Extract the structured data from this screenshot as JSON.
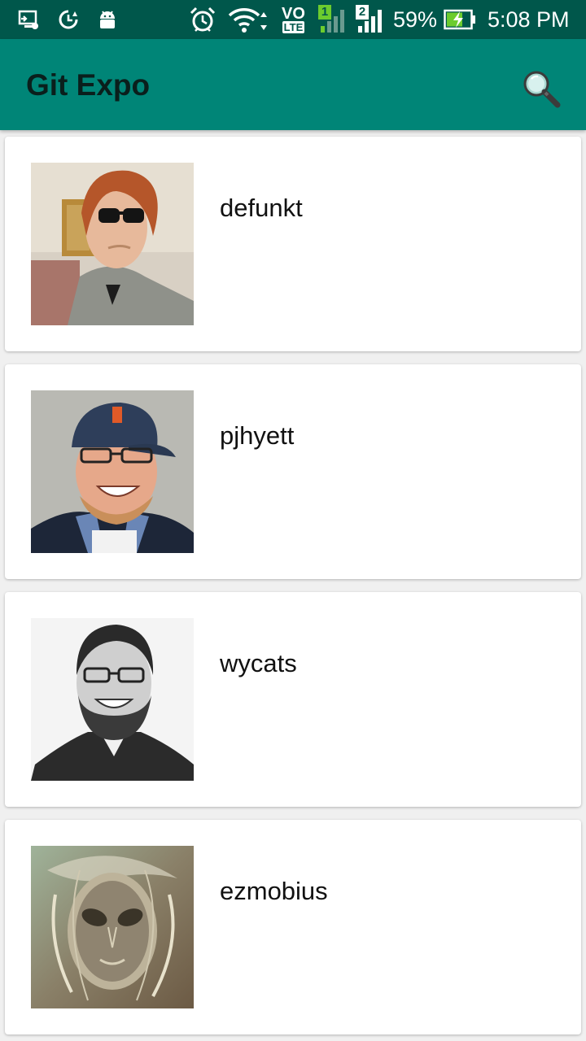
{
  "status_bar": {
    "battery_percent": "59%",
    "time": "5:08 PM",
    "network_label": "VO",
    "network_sub": "LTE",
    "sim1": "1",
    "sim2": "2",
    "icons": [
      "screen-cast-icon",
      "data-saver-icon",
      "android-icon",
      "alarm-icon",
      "wifi-icon",
      "volte-icon",
      "signal-sim1-icon",
      "signal-sim2-icon",
      "battery-charging-icon"
    ]
  },
  "app_bar": {
    "title": "Git Expo",
    "search_icon": "search-icon",
    "background": "#008577",
    "status_background": "#00574b"
  },
  "users": [
    {
      "login": "defunkt"
    },
    {
      "login": "pjhyett"
    },
    {
      "login": "wycats"
    },
    {
      "login": "ezmobius"
    }
  ]
}
